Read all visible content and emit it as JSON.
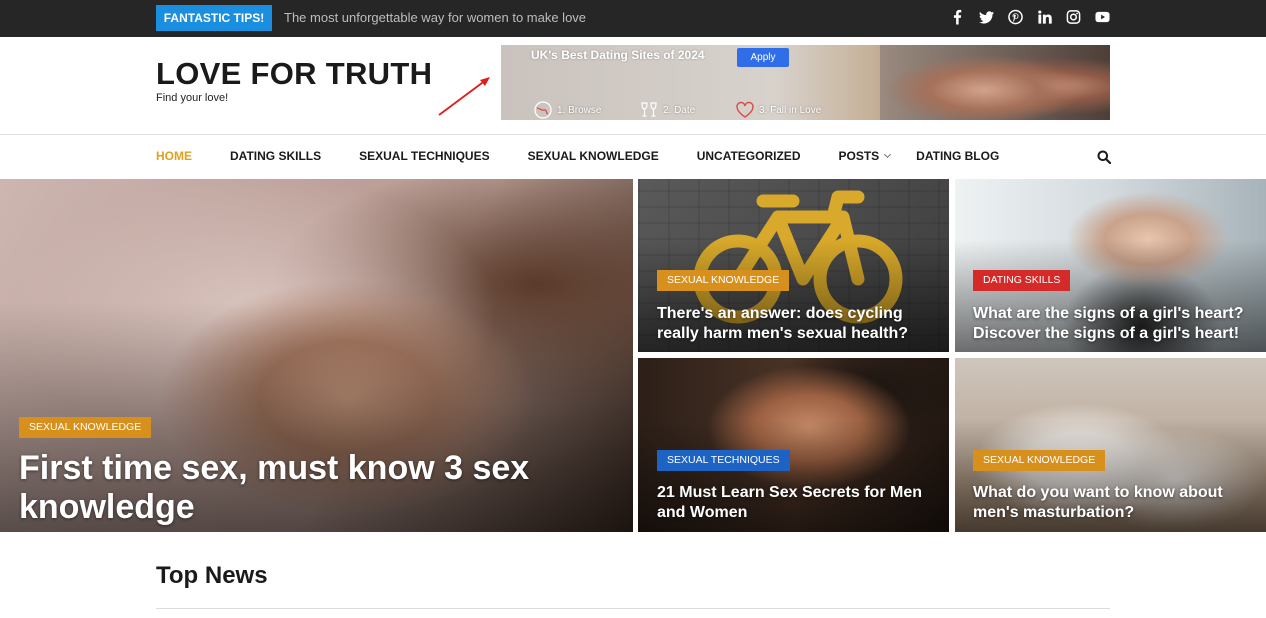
{
  "topbar": {
    "tips_label": "FANTASTIC TIPS!",
    "tip_text": "The most unforgettable way for women to make love",
    "socials": [
      "facebook-icon",
      "twitter-icon",
      "pinterest-icon",
      "linkedin-icon",
      "instagram-icon",
      "youtube-icon"
    ]
  },
  "header": {
    "logo": "LOVE FOR TRUTH",
    "tagline": "Find your love!"
  },
  "ad": {
    "title": "UK's Best Dating Sites of 2024",
    "apply_label": "Apply",
    "steps": [
      "1. Browse",
      "2. Date",
      "3. Fall in Love"
    ]
  },
  "nav": {
    "items": [
      "HOME",
      "DATING SKILLS",
      "SEXUAL TECHNIQUES",
      "SEXUAL KNOWLEDGE",
      "UNCATEGORIZED",
      "POSTS",
      "DATING BLOG"
    ],
    "active": "HOME"
  },
  "featured": [
    {
      "category": "SEXUAL KNOWLEDGE",
      "title": "First time sex, must know 3 sex knowledge"
    },
    {
      "category": "SEXUAL KNOWLEDGE",
      "title": "There's an answer: does cycling really harm men's sexual health?"
    },
    {
      "category": "DATING SKILLS",
      "title": "What are the signs of a girl's heart? Discover the signs of a girl's heart!"
    },
    {
      "category": "SEXUAL TECHNIQUES",
      "title": "21 Must Learn Sex Secrets for Men and Women"
    },
    {
      "category": "SEXUAL KNOWLEDGE",
      "title": "What do you want to know about men's masturbation?"
    }
  ],
  "section": {
    "title": "Top News"
  },
  "colors": {
    "accent": "#e0a11b",
    "tips_blue": "#1a8fe0",
    "badge_orange": "#d8901c",
    "badge_red": "#d42a2a",
    "badge_blue": "#1d63c4"
  }
}
